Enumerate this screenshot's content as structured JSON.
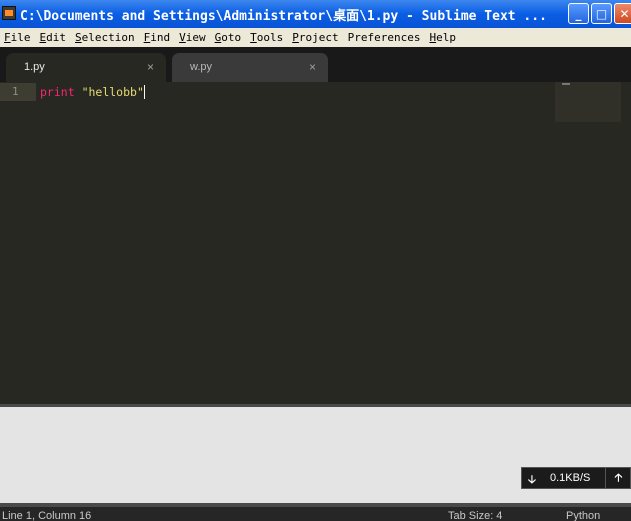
{
  "window": {
    "title": "C:\\Documents and Settings\\Administrator\\桌面\\1.py - Sublime Text ...",
    "min_label": "_",
    "max_label": "□",
    "close_label": "✕"
  },
  "menu": [
    {
      "u": "F",
      "rest": "ile"
    },
    {
      "u": "E",
      "rest": "dit"
    },
    {
      "u": "S",
      "rest": "election"
    },
    {
      "u": "F",
      "rest": "ind"
    },
    {
      "u": "V",
      "rest": "iew"
    },
    {
      "u": "G",
      "rest": "oto"
    },
    {
      "u": "T",
      "rest": "ools"
    },
    {
      "u": "P",
      "rest": "roject"
    },
    {
      "u": "",
      "rest": "Preferences",
      "u_inner": "n"
    },
    {
      "u": "H",
      "rest": "elp"
    }
  ],
  "tabs": [
    {
      "label": "1.py",
      "close": "×",
      "active": true
    },
    {
      "label": "w.py",
      "close": "×",
      "active": false
    }
  ],
  "editor": {
    "line_number": "1",
    "keyword": "print",
    "string": "\"hellobb\""
  },
  "network": {
    "down_icon": "🡣",
    "speed": "0.1KB/S",
    "up_icon": "🡡"
  },
  "status": {
    "position": "Line 1, Column 16",
    "tab_size": "Tab Size: 4",
    "syntax": "Python"
  },
  "colors": {
    "editor_bg": "#272822",
    "keyword": "#f92672",
    "string": "#e6db74",
    "title_bar": "#0a5ee4"
  }
}
